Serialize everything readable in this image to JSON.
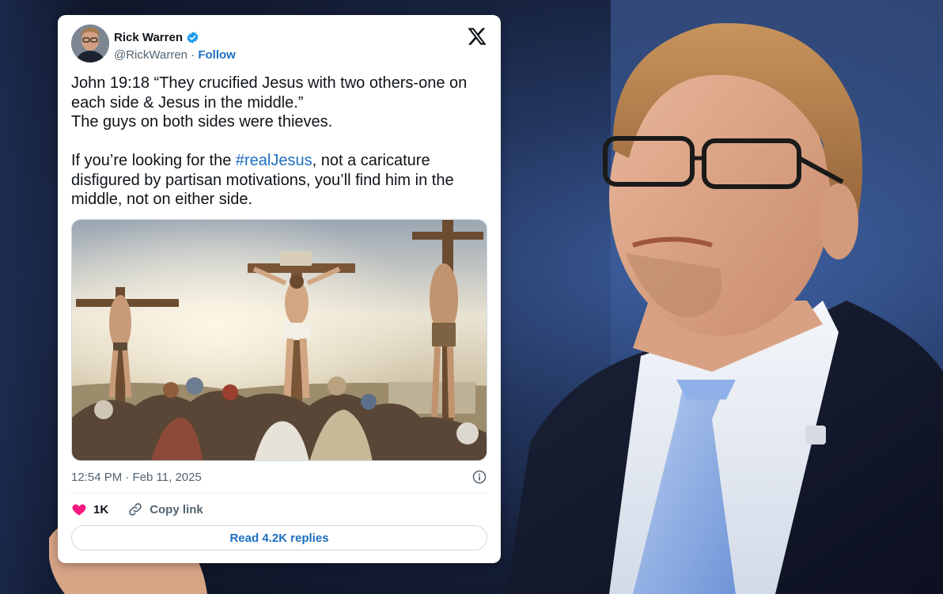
{
  "tweet": {
    "author": {
      "display_name": "Rick Warren",
      "handle": "@RickWarren",
      "separator": " · ",
      "follow_label": "Follow"
    },
    "text_part1": "John 19:18 “They crucified Jesus with two others-one on each side & Jesus in the middle.”\nThe guys on both sides were thieves.\n\nIf you’re looking for the ",
    "hashtag": "#realJesus",
    "text_part2": ", not a caricature disfigured by partisan motivations, you’ll find him in the middle, not on either side.",
    "timestamp": "12:54 PM · Feb 11, 2025",
    "like_count": "1K",
    "copy_link_label": "Copy link",
    "read_replies_label": "Read 4.2K replies"
  },
  "icons": {
    "verified": "verified-badge-icon",
    "platform_logo": "x-logo-icon",
    "info": "info-icon",
    "like": "heart-icon",
    "copy_link": "link-icon"
  },
  "colors": {
    "link_blue": "#1d6fc0",
    "verified_blue": "#1d9bf0",
    "heart_red": "#f91880",
    "text_primary": "#0f1419",
    "text_secondary": "#536471"
  }
}
